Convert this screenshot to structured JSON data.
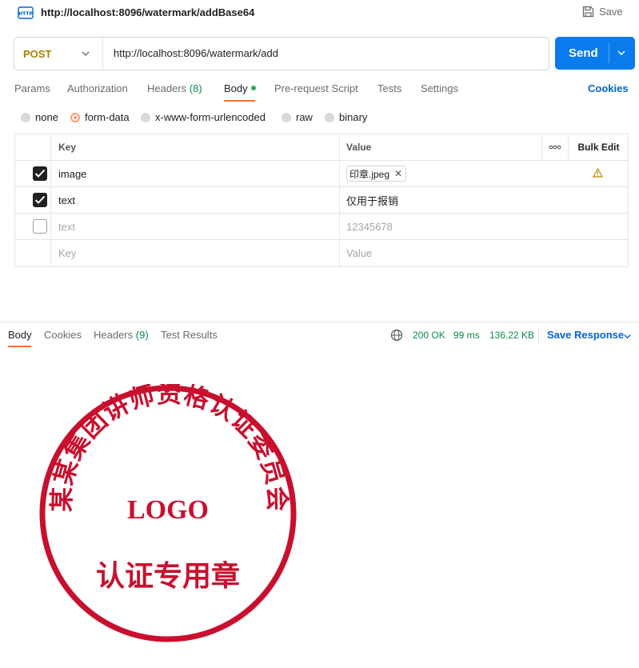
{
  "window": {
    "title": "http://localhost:8096/watermark/addBase64",
    "save_label": "Save",
    "icons": {
      "request_type": "http-icon",
      "save": "save-icon"
    }
  },
  "request": {
    "method": "POST",
    "url": "http://localhost:8096/watermark/add",
    "send_label": "Send"
  },
  "request_tabs": [
    {
      "label": "Params"
    },
    {
      "label": "Authorization"
    },
    {
      "label": "Headers",
      "count": "(8)"
    },
    {
      "label": "Body",
      "active": true
    },
    {
      "label": "Pre-request Script"
    },
    {
      "label": "Tests"
    },
    {
      "label": "Settings"
    }
  ],
  "cookies_link": "Cookies",
  "body_types": [
    {
      "label": "none",
      "selected": false
    },
    {
      "label": "form-data",
      "selected": true
    },
    {
      "label": "x-www-form-urlencoded",
      "selected": false
    },
    {
      "label": "raw",
      "selected": false
    },
    {
      "label": "binary",
      "selected": false
    }
  ],
  "params_table": {
    "headers": {
      "key": "Key",
      "value": "Value",
      "more": "ooo",
      "bulk_edit": "Bulk Edit"
    },
    "rows": [
      {
        "checked": true,
        "key": "image",
        "value": "印章.jpeg",
        "value_type": "file",
        "warning": true
      },
      {
        "checked": true,
        "key": "text",
        "value": "仅用于报销"
      },
      {
        "checked": false,
        "key": "text",
        "value": "12345678"
      }
    ],
    "placeholder": {
      "key": "Key",
      "value": "Value"
    }
  },
  "response": {
    "tabs": [
      {
        "label": "Body",
        "active": true
      },
      {
        "label": "Cookies"
      },
      {
        "label": "Headers",
        "count": "(9)"
      },
      {
        "label": "Test Results"
      }
    ],
    "status": "200 OK",
    "time": "99 ms",
    "size": "136.22 KB",
    "save_response_label": "Save Response"
  },
  "seal": {
    "ring_text": "某某集团讲师资格认证委员会",
    "logo": "LOGO",
    "bottom_text": "认证专用章",
    "color": "#c8102e"
  },
  "colors": {
    "accent": "#ff6c37",
    "send": "#097bed",
    "link": "#0265d2",
    "success": "#0f8a4b",
    "method": "#a97f00"
  }
}
